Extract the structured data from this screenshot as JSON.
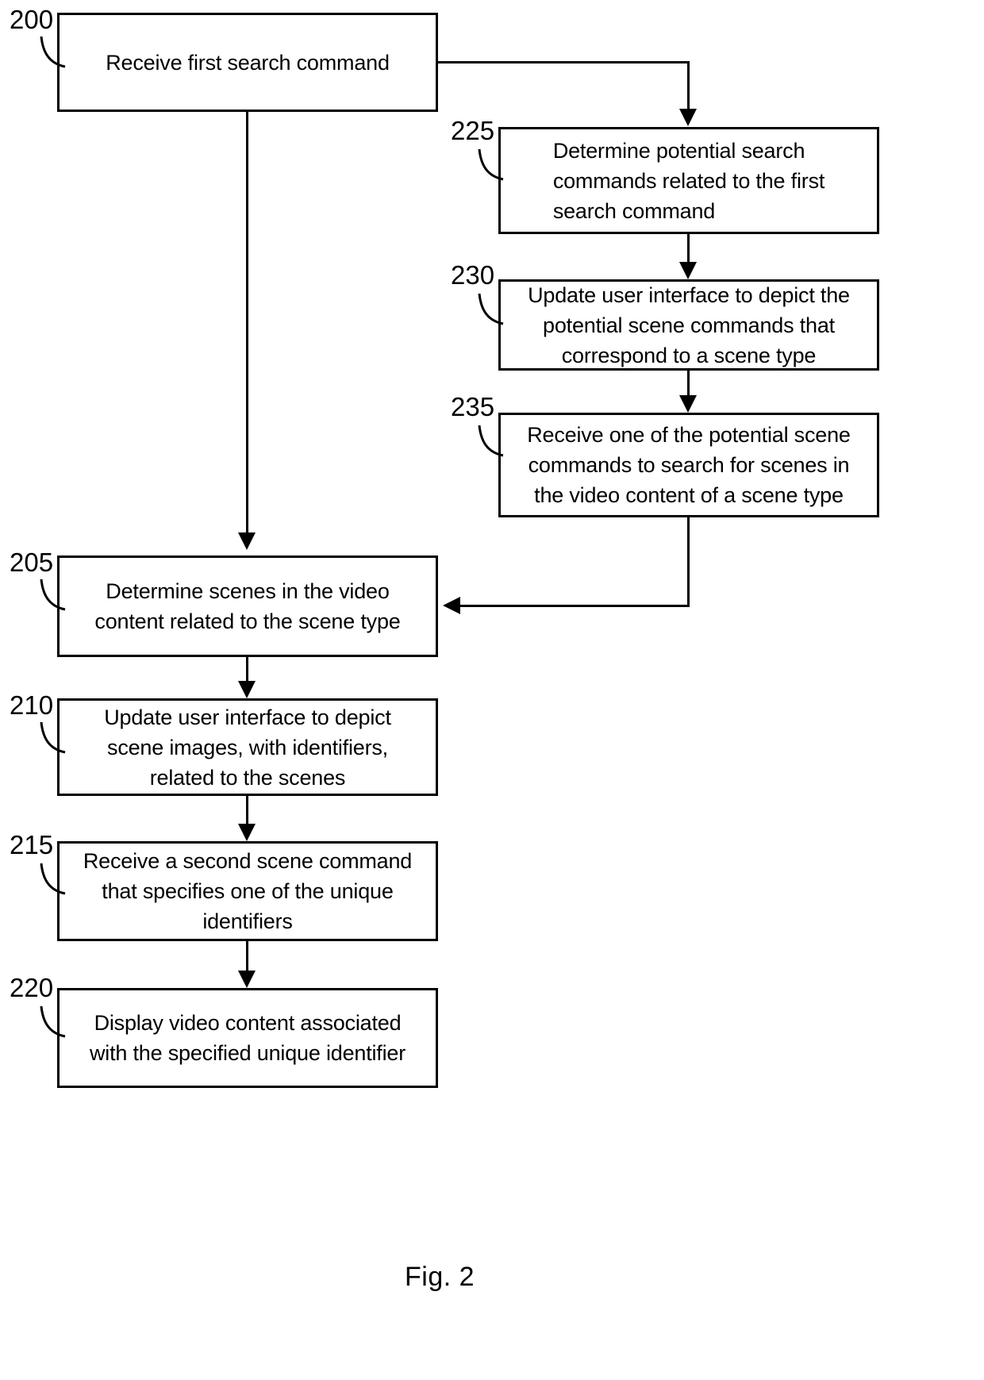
{
  "figure": {
    "caption": "Fig. 2"
  },
  "nodes": [
    {
      "ref": "200",
      "text": "Receive first search command"
    },
    {
      "ref": "225",
      "text": "Determine potential search\ncommands related to the first\nsearch command"
    },
    {
      "ref": "230",
      "text": "Update user interface to depict the\npotential scene commands that\ncorrespond to a scene type"
    },
    {
      "ref": "235",
      "text": "Receive one of the potential scene\ncommands to search for scenes in\nthe video content of a scene type"
    },
    {
      "ref": "205",
      "text": "Determine scenes in the video\ncontent related to the scene type"
    },
    {
      "ref": "210",
      "text": "Update user interface to depict\nscene images, with identifiers,\nrelated to the scenes"
    },
    {
      "ref": "215",
      "text": "Receive a second scene command\nthat specifies one of the unique\nidentifiers"
    },
    {
      "ref": "220",
      "text": "Display video content associated\nwith the specified unique identifier"
    }
  ],
  "colors": {
    "stroke": "#000000",
    "background": "#ffffff"
  }
}
